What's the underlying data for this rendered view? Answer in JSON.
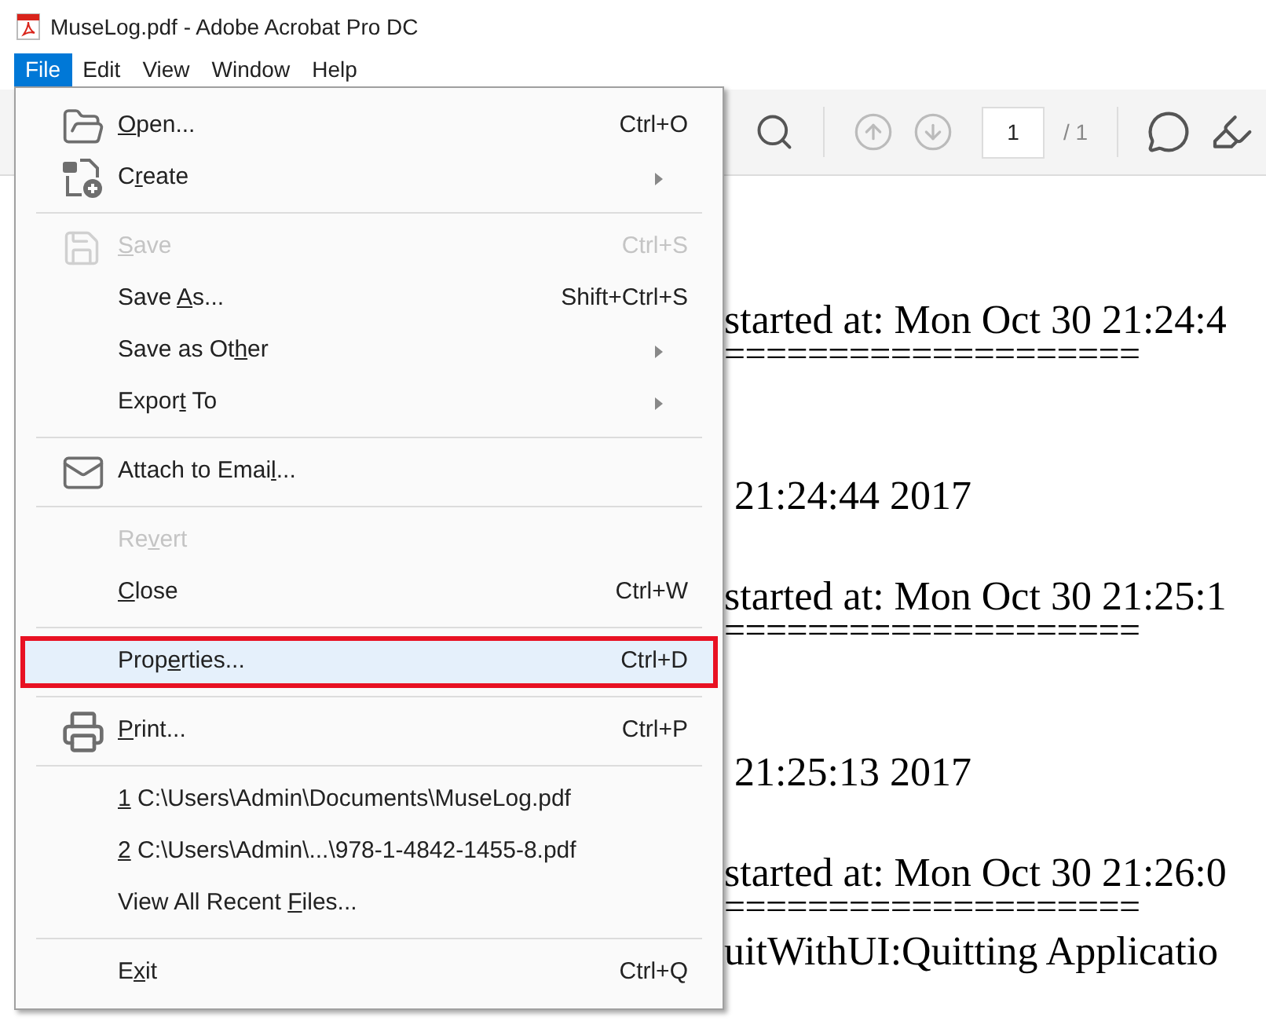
{
  "window": {
    "title": "MuseLog.pdf - Adobe Acrobat Pro DC"
  },
  "menubar": [
    {
      "label": "File",
      "selected": true
    },
    {
      "label": "Edit",
      "selected": false
    },
    {
      "label": "View",
      "selected": false
    },
    {
      "label": "Window",
      "selected": false
    },
    {
      "label": "Help",
      "selected": false
    }
  ],
  "toolbar": {
    "page_field": {
      "value": "1"
    },
    "page_total": "/ 1"
  },
  "document": {
    "lines": [
      {
        "kind": "text",
        "text": "started at: Mon Oct 30 21:24:4"
      },
      {
        "kind": "rule",
        "text": "===================="
      },
      {
        "kind": "text",
        "text": " 21:24:44 2017"
      },
      {
        "kind": "text",
        "text": "started at: Mon Oct 30 21:25:1"
      },
      {
        "kind": "rule",
        "text": "===================="
      },
      {
        "kind": "text",
        "text": " 21:25:13 2017"
      },
      {
        "kind": "text",
        "text": "started at: Mon Oct 30 21:26:0"
      },
      {
        "kind": "rule",
        "text": "===================="
      },
      {
        "kind": "text",
        "text": "uitWithUI:Quitting Applicatio"
      }
    ]
  },
  "file_menu": {
    "groups": [
      [
        {
          "access_key": "O",
          "label_end": "pen...",
          "shortcut": "Ctrl+O",
          "disabled": false,
          "selected": false,
          "outlined": false,
          "submenu": false
        },
        {
          "label_start": "C",
          "access_key": "r",
          "label_end": "eate",
          "disabled": false,
          "selected": false,
          "outlined": false,
          "submenu": true
        }
      ],
      [
        {
          "access_key": "S",
          "label_end": "ave",
          "shortcut": "Ctrl+S",
          "disabled": true,
          "selected": false,
          "outlined": false,
          "submenu": false
        },
        {
          "label_start": "Save ",
          "access_key": "A",
          "label_end": "s...",
          "shortcut": "Shift+Ctrl+S",
          "disabled": false,
          "selected": false,
          "outlined": false,
          "submenu": false
        },
        {
          "label_start": "Save as Ot",
          "access_key": "h",
          "label_end": "er",
          "disabled": false,
          "selected": false,
          "outlined": false,
          "submenu": true
        },
        {
          "label_start": "Expor",
          "access_key": "t",
          "label_end": " To",
          "disabled": false,
          "selected": false,
          "outlined": false,
          "submenu": true
        }
      ],
      [
        {
          "label_start": "Attach to Emai",
          "access_key": "l",
          "label_end": "...",
          "disabled": false,
          "selected": false,
          "outlined": false,
          "submenu": false
        }
      ],
      [
        {
          "label_start": "Re",
          "access_key": "v",
          "label_end": "ert",
          "disabled": true,
          "selected": false,
          "outlined": false,
          "submenu": false
        },
        {
          "access_key": "C",
          "label_end": "lose",
          "shortcut": "Ctrl+W",
          "disabled": false,
          "selected": false,
          "outlined": false,
          "submenu": false
        }
      ],
      [
        {
          "label_start": "Prop",
          "access_key": "e",
          "label_end": "rties...",
          "shortcut": "Ctrl+D",
          "disabled": false,
          "selected": true,
          "outlined": true,
          "submenu": false
        }
      ],
      [
        {
          "access_key": "P",
          "label_end": "rint...",
          "shortcut": "Ctrl+P",
          "disabled": false,
          "selected": false,
          "outlined": false,
          "submenu": false
        }
      ],
      [
        {
          "access_key": "1",
          "label_end": " C:\\Users\\Admin\\Documents\\MuseLog.pdf",
          "disabled": false,
          "selected": false,
          "outlined": false,
          "submenu": false
        },
        {
          "access_key": "2",
          "label_end": " C:\\Users\\Admin\\...\\978-1-4842-1455-8.pdf",
          "disabled": false,
          "selected": false,
          "outlined": false,
          "submenu": false
        },
        {
          "label_start": "View All Recent ",
          "access_key": "F",
          "label_end": "iles...",
          "disabled": false,
          "selected": false,
          "outlined": false,
          "submenu": false
        }
      ],
      [
        {
          "label_start": "E",
          "access_key": "x",
          "label_end": "it",
          "shortcut": "Ctrl+Q",
          "disabled": false,
          "selected": false,
          "outlined": false,
          "submenu": false
        }
      ]
    ]
  }
}
